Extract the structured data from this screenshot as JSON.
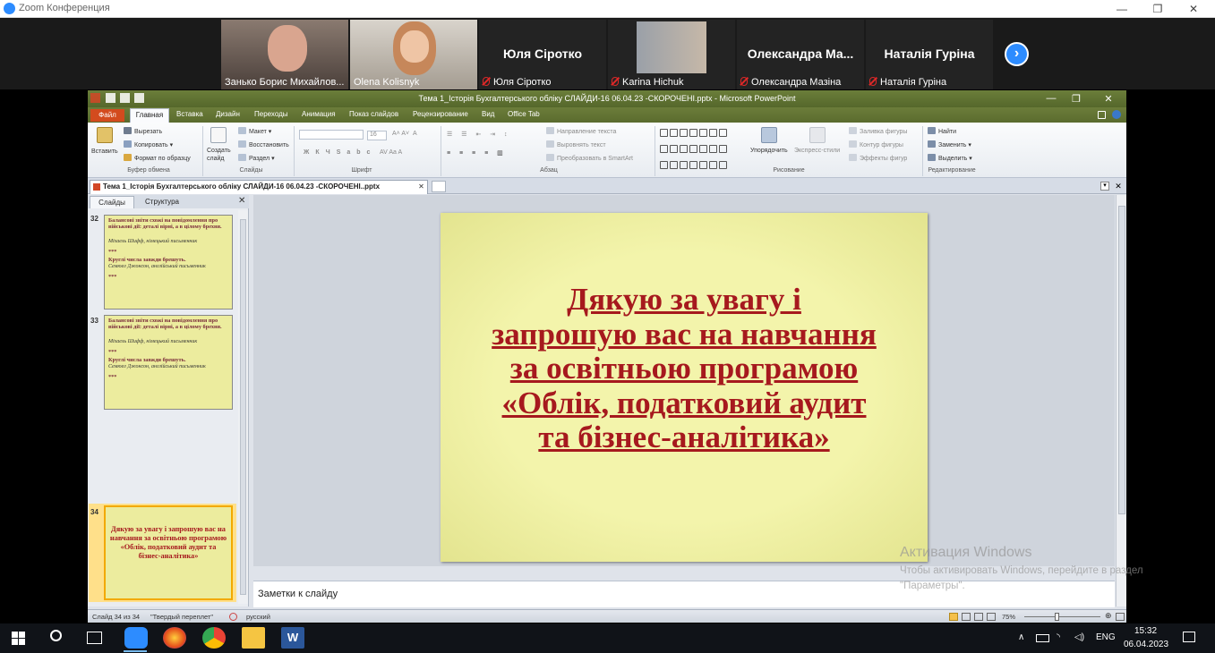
{
  "zoom": {
    "title": "Zoom Конференция",
    "participants": [
      {
        "name": "Занько Борис Михайлов...",
        "muted": false,
        "video": true
      },
      {
        "name": "Olena Kolisnyk",
        "muted": false,
        "video": true
      },
      {
        "name": "Юля Сіротко",
        "display_name": "Юля Сіротко",
        "muted": true,
        "video": false
      },
      {
        "name": "Karina Hichuk",
        "muted": true,
        "video": true
      },
      {
        "name": "Олександра Мазіна",
        "display_name": "Олександра Ма...",
        "muted": true,
        "video": false
      },
      {
        "name": "Наталія Гуріна",
        "display_name": "Наталія Гуріна",
        "muted": true,
        "video": false
      }
    ],
    "next_icon": "chevron-right-icon"
  },
  "ppt": {
    "title": "Тема 1_Історія Бухгалтерського обліку СЛАЙДИ-16 06.04.23 -СКОРОЧЕНІ.pptx - Microsoft PowerPoint",
    "ribbon_tabs": [
      "Файл",
      "Главная",
      "Вставка",
      "Дизайн",
      "Переходы",
      "Анимация",
      "Показ слайдов",
      "Рецензирование",
      "Вид",
      "Office Tab"
    ],
    "clipboard": {
      "paste": "Вставить",
      "cut": "Вырезать",
      "copy": "Копировать",
      "format": "Формат по образцу",
      "label": "Буфер обмена"
    },
    "slides": {
      "create": "Создать слайд",
      "layout": "Макет",
      "restore": "Восстановить",
      "section": "Раздел",
      "label": "Слайды"
    },
    "font": {
      "size": "16",
      "label": "Шрифт"
    },
    "paragraph": {
      "direction": "Направление текста",
      "align": "Выровнять текст",
      "smartart": "Преобразовать в SmartArt",
      "label": "Абзац"
    },
    "drawing": {
      "arrange": "Упорядочить",
      "quick_styles": "Экспресс-стили",
      "fill": "Заливка фигуры",
      "outline": "Контур фигуры",
      "effects": "Эффекты фигур",
      "label": "Рисование"
    },
    "editing": {
      "find": "Найти",
      "replace": "Заменить",
      "select": "Выделить",
      "label": "Редактирование"
    },
    "doc_tab": "Тема 1_Історія Бухгалтерського обліку СЛАЙДИ-16 06.04.23 -СКОРОЧЕНІ..pptx",
    "pane_tabs": {
      "slides": "Слайды",
      "outline": "Структура"
    },
    "thumbs": [
      {
        "num": "32",
        "text1": "Балансові звіти схожі на повідомлення про військові дії: деталі вірні, а в цілому брехня.",
        "author1": "Міхаель Шифф, німецький письменник",
        "stars1": "***",
        "text2": "Круглі числа завжди брешуть.",
        "author2": "Семюел Джонсон, англійський письменник",
        "stars2": "***"
      },
      {
        "num": "33",
        "text1": "Балансові звіти схожі на повідомлення про військові дії: деталі вірні, а в цілому брехня.",
        "author1": "Міхаель Шифф, німецький письменник",
        "stars1": "***",
        "text2": "Круглі числа завжди брешуть.",
        "author2": "Семюел Джонсон, англійський письменник",
        "stars2": "***"
      },
      {
        "num": "34",
        "text": "Дякую за увагу і запрошую вас на навчання за освітньою програмою «Облік, податковий аудит та бізнес-аналітика»"
      }
    ],
    "slide": {
      "lines": [
        "Дякую за увагу і",
        "запрошую вас на навчання",
        "за освітньою програмою",
        "«Облік, податковий аудит",
        "та бізнес-аналітика»"
      ]
    },
    "notes_placeholder": "Заметки к слайду",
    "status": {
      "slide": "Слайд 34 из 34",
      "theme": "\"Твердый переплет\"",
      "lang": "русский",
      "zoom": "75%"
    }
  },
  "watermark": {
    "title": "Активация Windows",
    "line1": "Чтобы активировать Windows, перейдите в раздел",
    "line2": "\"Параметры\"."
  },
  "taskbar": {
    "lang": "ENG",
    "time": "15:32",
    "date": "06.04.2023"
  }
}
